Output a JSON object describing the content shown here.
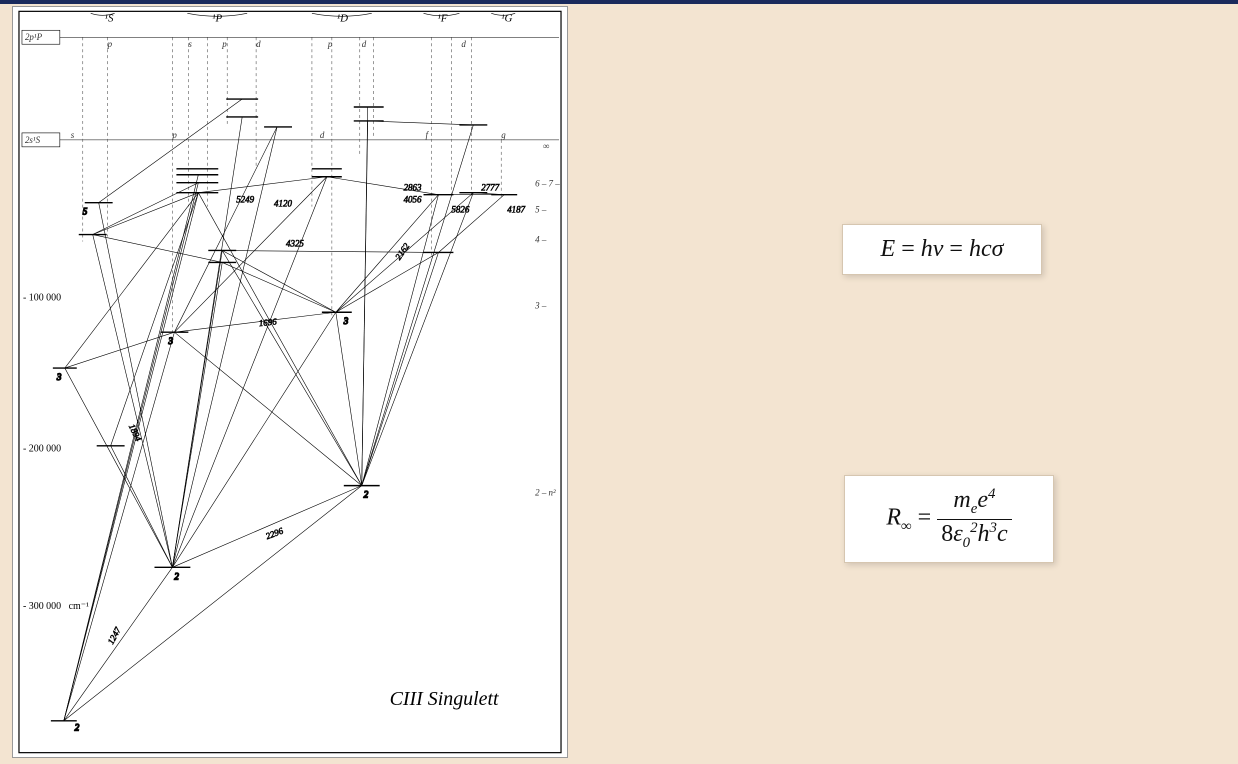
{
  "diagram": {
    "title": "CIII Singulett",
    "topTermLabels": [
      "¹S",
      "¹P",
      "¹D",
      "¹F",
      "¹G"
    ],
    "seriesLabel_top1": "2p¹P",
    "seriesLabel_top2": "2s¹S",
    "subTop_p": "p",
    "subTop_s": "s",
    "subTop_pd_p": "p",
    "subTop_pd_d": "d",
    "subTop_d_p": "p",
    "subTop_d_d": "d",
    "subTop_f_d": "d",
    "row2s_s": "s",
    "row2s_p": "p",
    "row2s_d": "d",
    "row2s_f": "f",
    "row2s_g": "g",
    "row2s_inf": "∞",
    "yTicks": [
      "- 100 000",
      "- 200 000",
      "- 300 000\n  cm⁻¹"
    ],
    "rightMarks": {
      "n2": "2 –\nn²",
      "n3": "3 –",
      "n4": "4 –",
      "n5": "5 –",
      "n67": "6 –\n7 –"
    },
    "lowest_n": "2",
    "level_n2": "2",
    "level_n3": "3",
    "wavelengths_sel": {
      "w2296": "2296",
      "w2863": "2863",
      "w4056": "4056",
      "w2162": "2162",
      "w4120": "4120",
      "w1696": "1696",
      "w4325": "4325",
      "w2777": "2777",
      "w5826": "5826",
      "w4187": "4187",
      "w1247": "1247",
      "w1894": "1894",
      "w5249": "5249"
    }
  },
  "equations": {
    "eq1_lhs": "E",
    "eq1_mid": "hν",
    "eq1_rhs": "hcσ",
    "eq2_lhs_R": "R",
    "eq2_lhs_inf": "∞",
    "eq2_num_me": "m",
    "eq2_num_e_sub": "e",
    "eq2_num_e": "e",
    "eq2_num_4": "4",
    "eq2_den_8": "8",
    "eq2_den_eps": "ε",
    "eq2_den_0": "0",
    "eq2_den_2": "2",
    "eq2_den_h": "h",
    "eq2_den_3": "3",
    "eq2_den_c": "c"
  }
}
